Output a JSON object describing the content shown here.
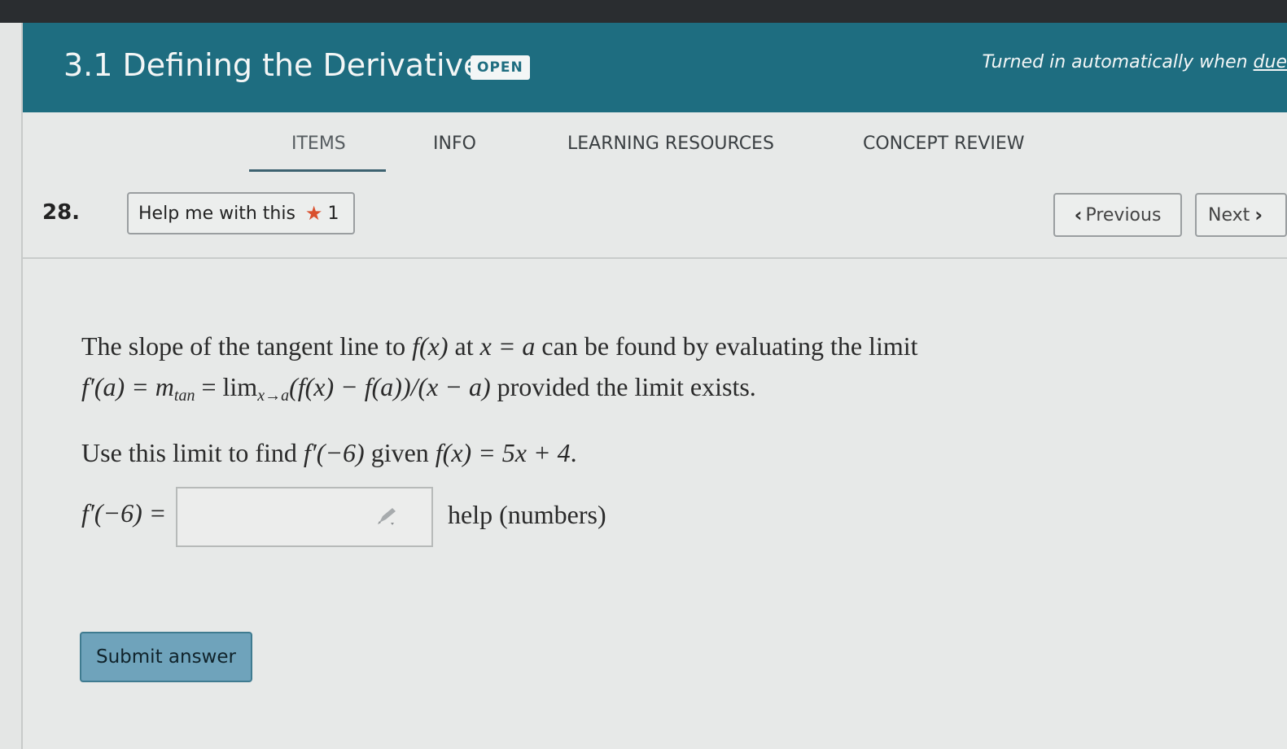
{
  "header": {
    "title": "3.1 Defining the Derivative",
    "status_badge": "OPEN",
    "turned_in_prefix": "Turned in automatically when ",
    "turned_in_link": "due"
  },
  "tabs": [
    {
      "label": "ITEMS",
      "active": true
    },
    {
      "label": "INFO",
      "active": false
    },
    {
      "label": "LEARNING RESOURCES",
      "active": false
    },
    {
      "label": "CONCEPT REVIEW",
      "active": false
    }
  ],
  "question": {
    "number": "28.",
    "help_button_label": "Help me with this",
    "help_count": "1",
    "prev_label": "Previous",
    "next_label": "Next",
    "text_line1_a": "The slope of the tangent line to ",
    "text_line1_fx": "f(x)",
    "text_line1_b": " at ",
    "text_line1_xa": "x = a",
    "text_line1_c": " can be found by evaluating the limit",
    "text_line2_a": "f′(a) = m",
    "text_line2_sub_tan": "tan",
    "text_line2_b": " = lim",
    "text_line2_sub_lim": "x→a",
    "text_line2_c": "(f(x) − f(a))/(x − a)",
    "text_line2_d": " provided the limit exists.",
    "text_line3_a": "Use this limit to find ",
    "text_line3_b": "f′(−6)",
    "text_line3_c": " given ",
    "text_line3_d": "f(x) = 5x + 4",
    "text_line3_e": ".",
    "answer_label": "f′(−6) =",
    "answer_value": "",
    "help_link_label": "help (numbers)",
    "submit_label": "Submit answer"
  },
  "colors": {
    "header_bg": "#1e6d80",
    "submit_bg": "#6fa3bb",
    "star": "#d9502e"
  },
  "icons": {
    "star": "star-icon",
    "previous": "chevron-left-icon",
    "next": "chevron-right-icon",
    "pencil": "pencil-icon"
  }
}
